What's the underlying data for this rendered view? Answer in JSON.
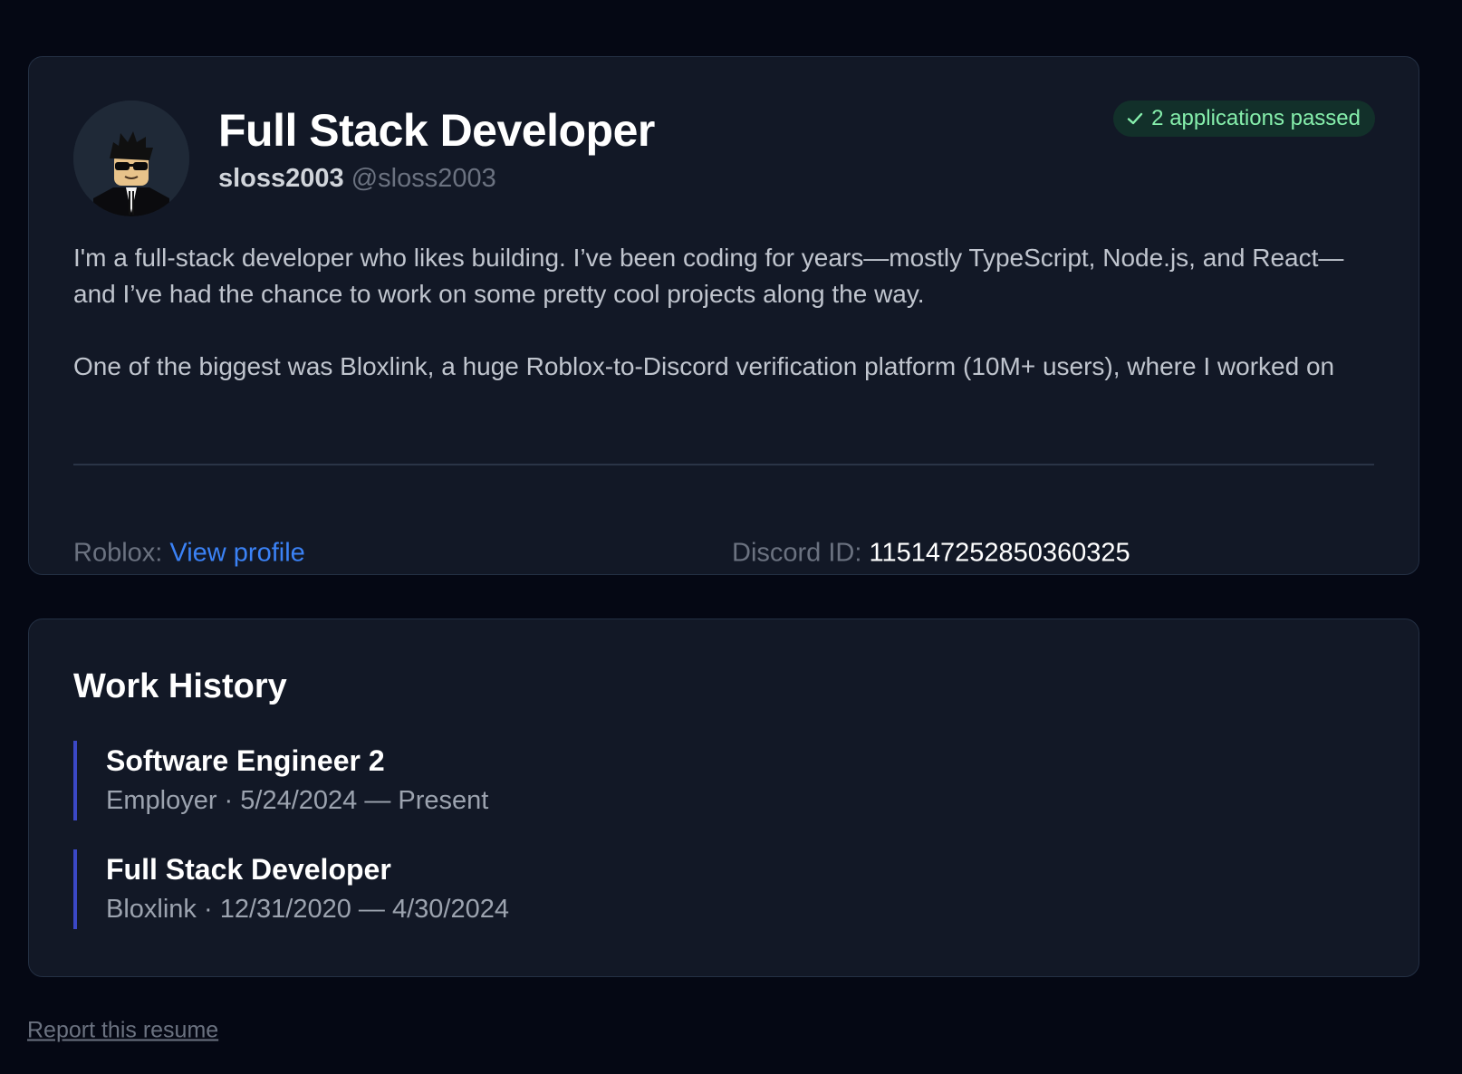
{
  "profile": {
    "title": "Full Stack Developer",
    "display_name": "sloss2003",
    "username": "@sloss2003",
    "badge_label": "2 applications passed",
    "bio": [
      "I'm a full-stack developer who likes building. I’ve been coding for years—mostly TypeScript, Node.js, and React—and I’ve had the chance to work on some pretty cool projects along the way.",
      "One of the biggest was Bloxlink, a huge Roblox-to-Discord verification platform (10M+ users), where I worked on"
    ],
    "roblox_label": "Roblox:",
    "roblox_link": "View profile",
    "discord_label": "Discord ID:",
    "discord_id": "115147252850360325"
  },
  "work_history": {
    "title": "Work History",
    "jobs": [
      {
        "title": "Software Engineer 2",
        "meta": "Employer · 5/24/2024 — Present"
      },
      {
        "title": "Full Stack Developer",
        "meta": "Bloxlink · 12/31/2020 — 4/30/2024"
      }
    ]
  },
  "footer": {
    "report_label": "Report this resume"
  },
  "colors": {
    "background": "#050814",
    "card": "#121826",
    "accent_link": "#3b82f6",
    "badge_text": "#86efac",
    "job_border": "#3b48c6"
  },
  "icons": {
    "badge": "check-icon",
    "avatar": "roblox-avatar"
  }
}
